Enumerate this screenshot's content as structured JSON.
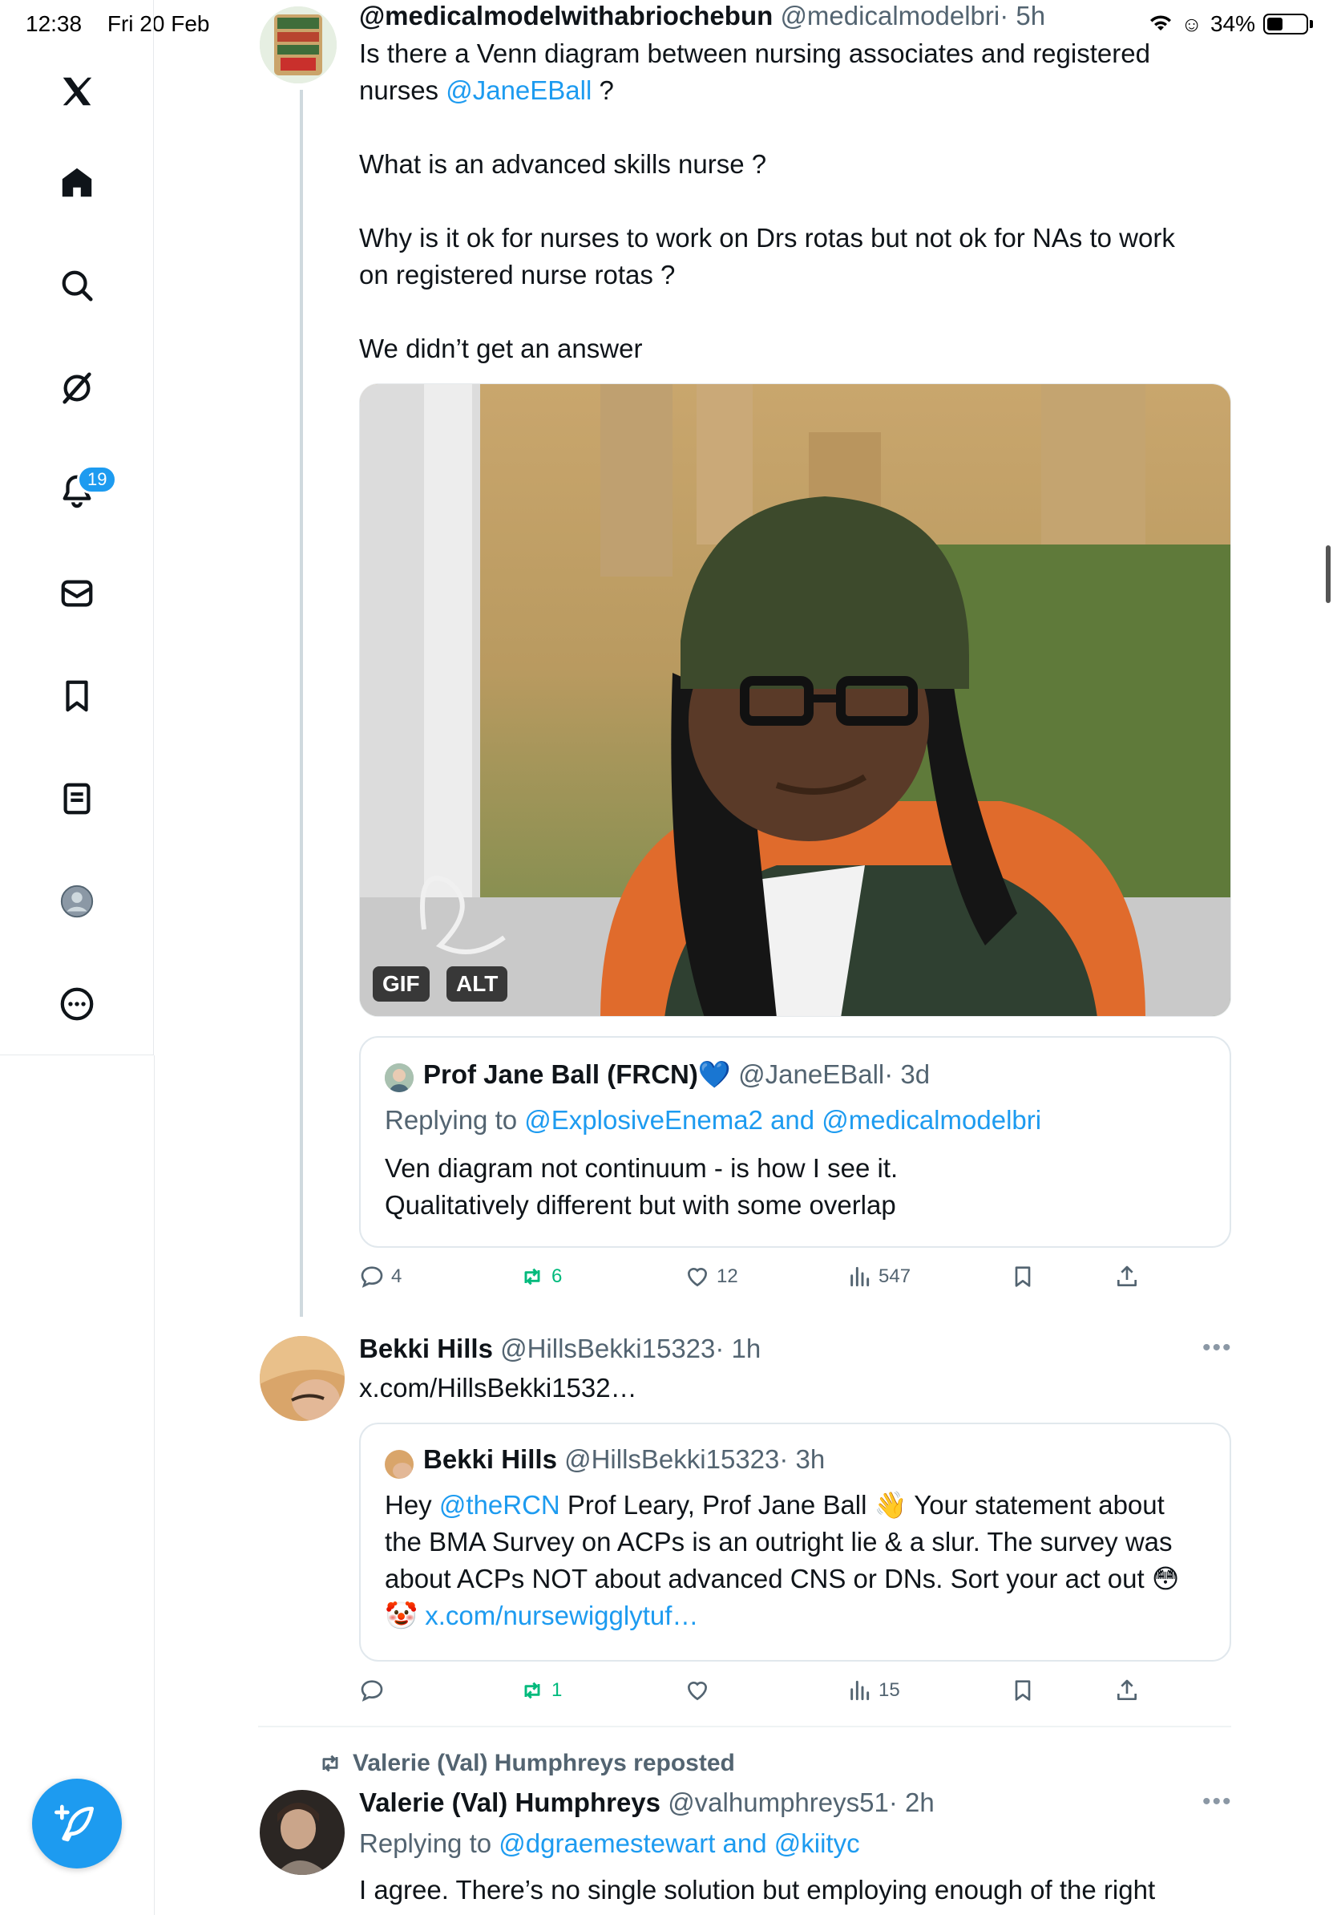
{
  "status_bar": {
    "time": "12:38",
    "date": "Fri 20 Feb",
    "battery": "34%"
  },
  "sidebar": {
    "items": [
      {
        "icon": "x-logo-icon"
      },
      {
        "icon": "home-icon"
      },
      {
        "icon": "search-icon"
      },
      {
        "icon": "grok-icon"
      },
      {
        "icon": "bell-icon",
        "badge": "19"
      },
      {
        "icon": "mail-icon"
      },
      {
        "icon": "bookmark-icon"
      },
      {
        "icon": "lists-icon"
      },
      {
        "icon": "profile-icon"
      },
      {
        "icon": "more-circle-icon"
      }
    ],
    "compose_icon": "compose-icon"
  },
  "tweet1": {
    "name": "@medicalmodelwithabriochebun",
    "handle": "@medicalmodelbri",
    "time": "· 5h",
    "line1": "Is there a Venn diagram between nursing associates and registered",
    "line2_pre": "nurses ",
    "mention": "@JaneEBall",
    "line2_post": " ?",
    "para2": "What is an advanced skills nurse ?",
    "para3a": "Why is it ok for nurses to work on Drs rotas but not ok for NAs to work",
    "para3b": "on registered nurse rotas ?",
    "para4": "We didn’t get an answer",
    "media_tags": [
      "GIF",
      "ALT"
    ],
    "quote": {
      "name": "Prof Jane Ball (FRCN)",
      "emoji": "💙",
      "handle": "@JaneEBall",
      "time": "· 3d",
      "replying_prefix": "Replying to ",
      "replying_links": "@ExplosiveEnema2 and @medicalmodelbri",
      "line1": "Ven diagram not continuum - is how I see it.",
      "line2": "Qualitatively different but with some overlap"
    },
    "actions": {
      "replies": "4",
      "reposts": "6",
      "likes": "12",
      "views": "547"
    }
  },
  "tweet2": {
    "name": "Bekki Hills",
    "handle": "@HillsBekki15323",
    "time": "· 1h",
    "link": "x.com/HillsBekki1532…",
    "quote": {
      "name": "Bekki Hills",
      "handle": "@HillsBekki15323",
      "time": "· 3h",
      "line1_pre": "Hey ",
      "line1_mention": "@theRCN",
      "line1_post": " Prof Leary, Prof Jane Ball 👋 Your statement about",
      "line2": "the BMA Survey on ACPs is an outright lie & a slur. The survey was",
      "line3": "about ACPs NOT about advanced CNS or DNs. Sort your act out 😳",
      "line4_emoji": "🤡",
      "line4_link": "x.com/nursewigglytuf…"
    },
    "actions": {
      "reposts": "1",
      "views": "15"
    }
  },
  "tweet3": {
    "reposted_by": "Valerie (Val) Humphreys reposted",
    "name": "Valerie (Val) Humphreys",
    "handle": "@valhumphreys51",
    "time": "· 2h",
    "replying_prefix": "Replying to ",
    "replying_links": "@dgraemestewart and @kiityc",
    "line1": "I agree. There’s no single solution but employing enough of the right"
  },
  "colors": {
    "accent": "#1d9bf0",
    "repost_green": "#00ba7c",
    "muted": "#536471"
  }
}
